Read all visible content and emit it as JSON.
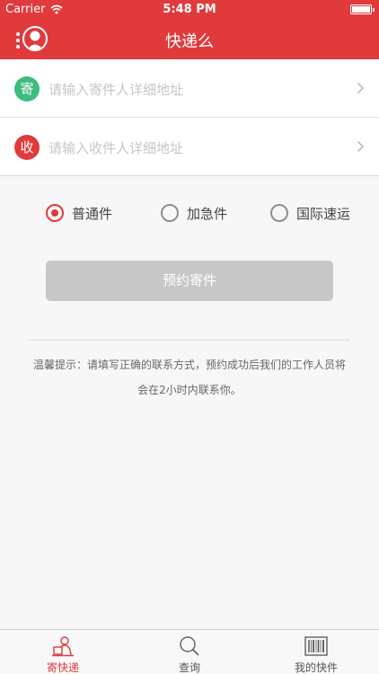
{
  "status": {
    "carrier": "Carrier",
    "time": "5:48 PM"
  },
  "nav": {
    "title": "快递么"
  },
  "sender": {
    "badge": "寄",
    "placeholder": "请输入寄件人详细地址"
  },
  "receiver": {
    "badge": "收",
    "placeholder": "请输入收件人详细地址"
  },
  "shipping_options": {
    "selected": "普通件",
    "options": [
      {
        "label": "普通件"
      },
      {
        "label": "加急件"
      },
      {
        "label": "国际速运"
      }
    ]
  },
  "submit": {
    "label": "预约寄件"
  },
  "tip": {
    "line1": "温馨提示：请填写正确的联系方式，预约成功后我们的工作人员将",
    "line2": "会在2小时内联系你。"
  },
  "tabs": [
    {
      "label": "寄快递",
      "icon": "courier-icon",
      "active": true
    },
    {
      "label": "查询",
      "icon": "search-icon",
      "active": false
    },
    {
      "label": "我的快件",
      "icon": "barcode-icon",
      "active": false
    }
  ],
  "colors": {
    "primary": "#e03a3c",
    "send_badge": "#3dbd7d",
    "disabled_button": "#c7c7c7"
  }
}
